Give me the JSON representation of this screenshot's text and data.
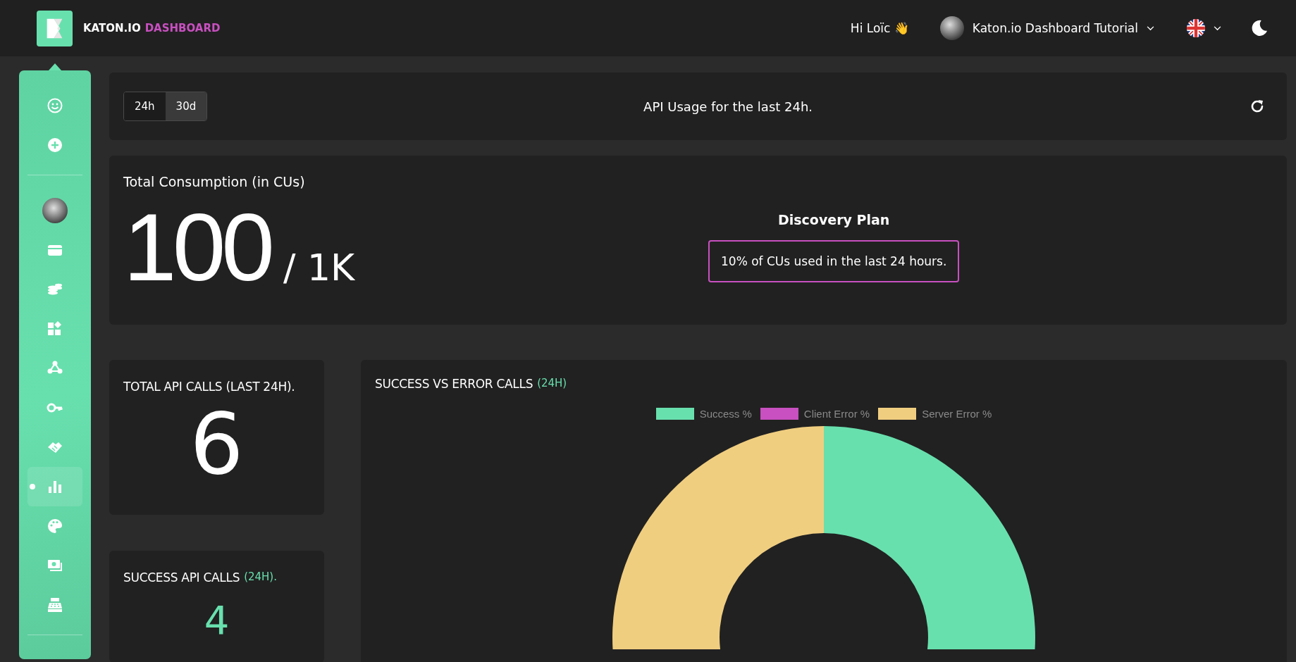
{
  "header": {
    "brand": "KATON.IO",
    "brand_suffix": "DASHBOARD",
    "greeting": "Hi Loïc 👋",
    "project": "Katon.io Dashboard Tutorial"
  },
  "sidebar": {
    "sections": [
      {
        "items": [
          {
            "kind": "icon",
            "selected": false
          },
          {
            "kind": "icon",
            "selected": false
          }
        ]
      },
      {
        "items": [
          {
            "kind": "avatar",
            "selected": false
          },
          {
            "kind": "icon",
            "selected": false
          },
          {
            "kind": "icon",
            "selected": false
          },
          {
            "kind": "icon",
            "selected": false
          },
          {
            "kind": "icon",
            "selected": false
          },
          {
            "kind": "icon",
            "selected": false
          },
          {
            "kind": "icon",
            "selected": false
          },
          {
            "kind": "icon",
            "selected": true
          },
          {
            "kind": "icon",
            "selected": false
          },
          {
            "kind": "icon",
            "selected": false
          },
          {
            "kind": "icon",
            "selected": false
          }
        ]
      }
    ]
  },
  "usage_bar": {
    "tabs": [
      {
        "label": "24h",
        "selected": true
      },
      {
        "label": "30d",
        "selected": false
      }
    ],
    "title": "API Usage for the last 24h."
  },
  "consumption": {
    "title": "Total Consumption (in CUs)",
    "used": "100",
    "limit": "/ 1K",
    "plan": "Discovery Plan",
    "plan_note": "10% of CUs used in the last 24 hours."
  },
  "total_calls": {
    "title": "TOTAL API CALLS (LAST 24H).",
    "value": "6"
  },
  "success_calls": {
    "title": "SUCCESS API CALLS",
    "period": "(24H).",
    "value": "4"
  },
  "calls_chart": {
    "title": "SUCCESS VS ERROR CALLS",
    "period": "(24H)",
    "legend": [
      {
        "label": "Success %",
        "color": "#68e0ae"
      },
      {
        "label": "Client Error %",
        "color": "#c850c0"
      },
      {
        "label": "Server Error %",
        "color": "#f0ce80"
      }
    ]
  }
}
